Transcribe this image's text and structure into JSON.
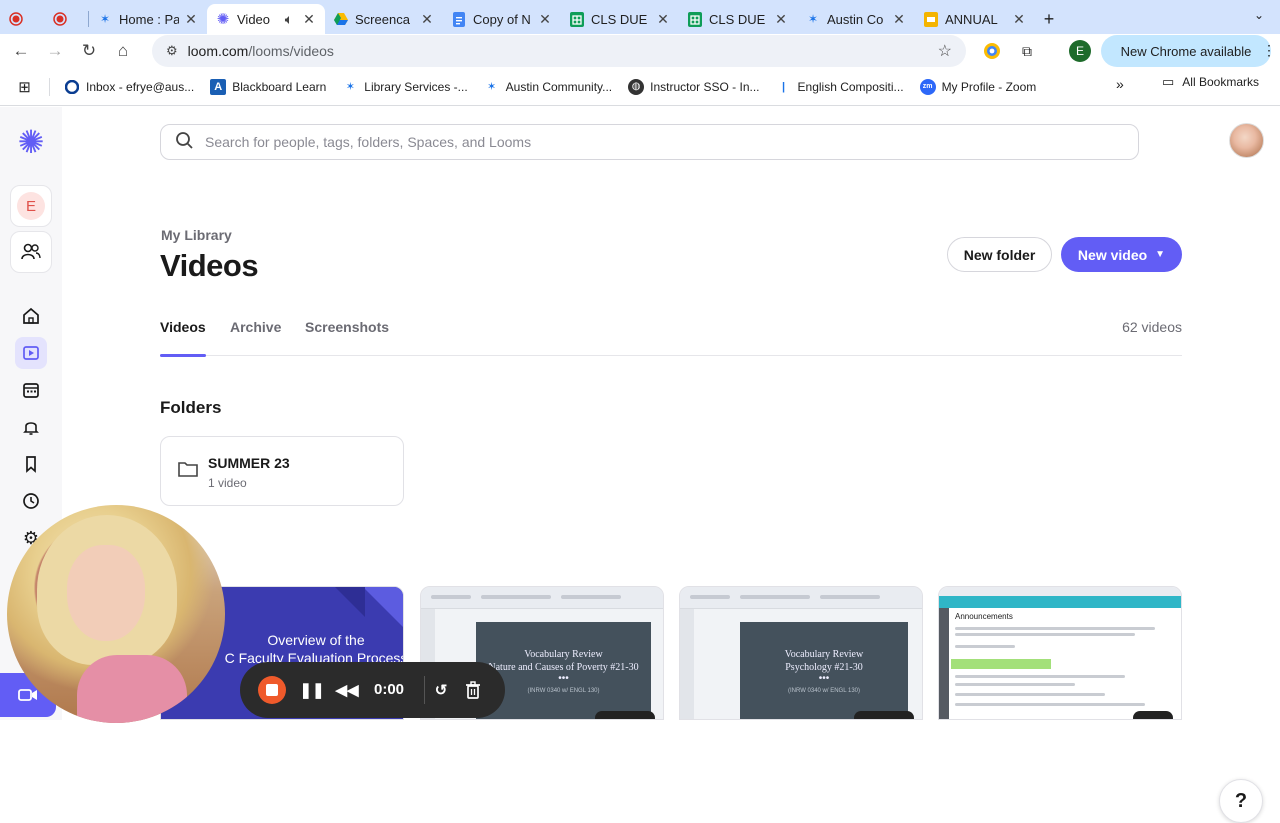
{
  "browser": {
    "tabs": [
      {
        "title": "",
        "icon": "record-icon"
      },
      {
        "title": "",
        "icon": "record-icon"
      },
      {
        "title": "Home : Pa",
        "icon": "acc-star-icon"
      },
      {
        "title": "Video",
        "icon": "loom-icon",
        "active": true,
        "audio": true
      },
      {
        "title": "Screenca",
        "icon": "drive-icon"
      },
      {
        "title": "Copy of N",
        "icon": "docs-icon"
      },
      {
        "title": "CLS DUE",
        "icon": "sheets-icon"
      },
      {
        "title": "CLS DUE",
        "icon": "sheets-icon"
      },
      {
        "title": "Austin Co",
        "icon": "acc-star-icon"
      },
      {
        "title": "ANNUAL",
        "icon": "slides-icon"
      }
    ],
    "url_host": "loom.com",
    "url_path": "/looms/videos",
    "update_pill": "New Chrome available",
    "profile_initial": "E",
    "bookmarks": [
      {
        "label": "Inbox - efrye@aus...",
        "icon": "outlook-icon"
      },
      {
        "label": "Blackboard Learn",
        "icon": "blackboard-icon"
      },
      {
        "label": "Library Services -...",
        "icon": "acc-star-icon"
      },
      {
        "label": "Austin Community...",
        "icon": "acc-star-icon"
      },
      {
        "label": "Instructor SSO - In...",
        "icon": "globe-icon"
      },
      {
        "label": "English Compositi...",
        "icon": "bookmark-icon"
      },
      {
        "label": "My Profile - Zoom",
        "icon": "zoom-icon"
      }
    ],
    "all_bookmarks": "All Bookmarks"
  },
  "loom": {
    "workspace_initial": "E",
    "search_placeholder": "Search for people, tags, folders, Spaces, and Looms",
    "breadcrumb": "My Library",
    "title": "Videos",
    "new_folder": "New folder",
    "new_video": "New video",
    "tabs": [
      "Videos",
      "Archive",
      "Screenshots"
    ],
    "video_count": "62 videos",
    "folders_heading": "Folders",
    "folder": {
      "name": "SUMMER 23",
      "count": "1 video"
    },
    "videos_heading": "s",
    "thumbs": [
      {
        "line1": "Overview of the",
        "line2": "C Faculty Evaluation Process"
      },
      {
        "line1": "Vocabulary Review",
        "line2": "Nature and Causes of Poverty #21-30",
        "dots": "•••",
        "sub": "(INRW 0340 w/ ENGL 130)"
      },
      {
        "line1": "Vocabulary Review",
        "line2": "Psychology #21-30",
        "dots": "•••",
        "sub": "(INRW 0340 w/ ENGL 130)"
      },
      {
        "line1": "Announcements"
      }
    ]
  },
  "recorder": {
    "time": "0:00"
  },
  "help": "?"
}
